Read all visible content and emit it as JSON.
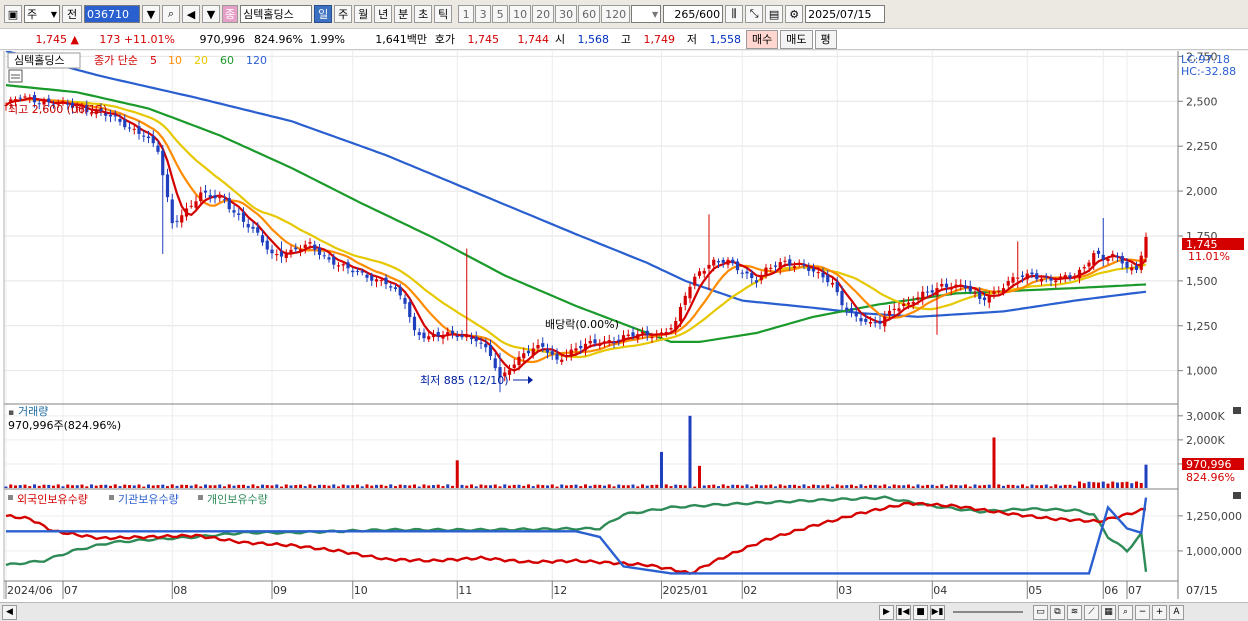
{
  "toolbar": {
    "period_type": "주",
    "prev_label": "전",
    "stock_code": "036710",
    "stock_name": "심텍홀딩스",
    "stock_badge": "종",
    "timeframes": [
      "일",
      "주",
      "월",
      "년",
      "분",
      "초",
      "틱"
    ],
    "selected_timeframe": "일",
    "intervals": [
      "1",
      "3",
      "5",
      "10",
      "20",
      "30",
      "60",
      "120"
    ],
    "count": "265",
    "count_max": "/600",
    "date": "2025/07/15"
  },
  "quote": {
    "price": "1,745",
    "arrow": "▲",
    "change": "173",
    "change_pct": "+11.01%",
    "volume": "970,996",
    "vol_ratio": "824.96%",
    "turnover": "1.99%",
    "amount": "1,641백만",
    "hoga_label": "호가",
    "ask": "1,745",
    "bid": "1,744",
    "open_label": "시",
    "open": "1,568",
    "high_label": "고",
    "high": "1,749",
    "low_label": "저",
    "low": "1,558",
    "buy_label": "매수",
    "sell_label": "매도",
    "eval_label": "평"
  },
  "chart_data": [
    {
      "type": "candlestick",
      "title": "심텍홀딩스",
      "legend": {
        "label": "종가 단순",
        "periods": [
          "5",
          "10",
          "20",
          "60",
          "120"
        ],
        "colors": [
          "#d40000",
          "#ff8c00",
          "#e6c800",
          "#1a9a2a",
          "#2a5fd0"
        ]
      },
      "x_ticks": [
        "2024/06",
        "07",
        "08",
        "09",
        "10",
        "11",
        "12",
        "2025/01",
        "02",
        "03",
        "04",
        "05",
        "06",
        "07"
      ],
      "y_ticks": [
        1000,
        1250,
        1500,
        1750,
        2000,
        2250,
        2500,
        2750
      ],
      "ylim": [
        820,
        2780
      ],
      "lc": "LC:97.18",
      "hc": "HC:-32.88",
      "annotations": {
        "high": "최고 2,600 (06/12)",
        "low": "최저 885 (12/10)",
        "dividend": "배당락(0.00%)"
      },
      "last_price_label": "1,745",
      "last_change_label": "11.01%",
      "close_anchors": [
        [
          0,
          2480
        ],
        [
          3,
          2520
        ],
        [
          8,
          2500
        ],
        [
          14,
          2470
        ],
        [
          20,
          2440
        ],
        [
          24,
          2380
        ],
        [
          29,
          2320
        ],
        [
          32,
          2220
        ],
        [
          34,
          1950
        ],
        [
          35,
          1820
        ],
        [
          38,
          1900
        ],
        [
          41,
          1980
        ],
        [
          46,
          1950
        ],
        [
          50,
          1830
        ],
        [
          53,
          1750
        ],
        [
          56,
          1650
        ],
        [
          60,
          1660
        ],
        [
          64,
          1700
        ],
        [
          68,
          1620
        ],
        [
          72,
          1560
        ],
        [
          77,
          1520
        ],
        [
          80,
          1490
        ],
        [
          84,
          1380
        ],
        [
          86,
          1220
        ],
        [
          89,
          1190
        ],
        [
          95,
          1200
        ],
        [
          99,
          1180
        ],
        [
          102,
          1080
        ],
        [
          104,
          950
        ],
        [
          106,
          1020
        ],
        [
          109,
          1100
        ],
        [
          113,
          1130
        ],
        [
          116,
          1060
        ],
        [
          118,
          1100
        ],
        [
          122,
          1140
        ],
        [
          127,
          1170
        ],
        [
          131,
          1190
        ],
        [
          134,
          1200
        ],
        [
          138,
          1210
        ],
        [
          141,
          1260
        ],
        [
          143,
          1420
        ],
        [
          146,
          1560
        ],
        [
          149,
          1610
        ],
        [
          152,
          1600
        ],
        [
          155,
          1550
        ],
        [
          158,
          1510
        ],
        [
          160,
          1560
        ],
        [
          164,
          1600
        ],
        [
          168,
          1590
        ],
        [
          171,
          1530
        ],
        [
          174,
          1480
        ],
        [
          176,
          1380
        ],
        [
          179,
          1300
        ],
        [
          182,
          1250
        ],
        [
          184,
          1270
        ],
        [
          187,
          1360
        ],
        [
          190,
          1370
        ],
        [
          193,
          1420
        ],
        [
          197,
          1480
        ],
        [
          202,
          1460
        ],
        [
          205,
          1400
        ],
        [
          209,
          1450
        ],
        [
          213,
          1520
        ],
        [
          216,
          1540
        ],
        [
          220,
          1500
        ],
        [
          224,
          1520
        ],
        [
          227,
          1580
        ],
        [
          229,
          1660
        ],
        [
          231,
          1610
        ],
        [
          233,
          1640
        ],
        [
          236,
          1590
        ],
        [
          238,
          1560
        ],
        [
          240,
          1745
        ]
      ],
      "ma120_anchors": [
        [
          0,
          2780
        ],
        [
          20,
          2640
        ],
        [
          40,
          2520
        ],
        [
          60,
          2390
        ],
        [
          80,
          2200
        ],
        [
          100,
          1980
        ],
        [
          120,
          1760
        ],
        [
          135,
          1600
        ],
        [
          143,
          1500
        ],
        [
          155,
          1390
        ],
        [
          170,
          1350
        ],
        [
          180,
          1320
        ],
        [
          192,
          1300
        ],
        [
          210,
          1330
        ],
        [
          225,
          1390
        ],
        [
          240,
          1440
        ]
      ],
      "ma60_anchors": [
        [
          0,
          2590
        ],
        [
          15,
          2550
        ],
        [
          30,
          2460
        ],
        [
          45,
          2310
        ],
        [
          60,
          2130
        ],
        [
          75,
          1930
        ],
        [
          90,
          1740
        ],
        [
          105,
          1530
        ],
        [
          120,
          1360
        ],
        [
          132,
          1240
        ],
        [
          140,
          1160
        ],
        [
          146,
          1160
        ],
        [
          158,
          1210
        ],
        [
          170,
          1300
        ],
        [
          184,
          1370
        ],
        [
          200,
          1430
        ],
        [
          225,
          1460
        ],
        [
          240,
          1480
        ]
      ],
      "spikes": [
        [
          33,
          1650,
          2050
        ],
        [
          58,
          1600,
          1720
        ],
        [
          97,
          1300,
          1680
        ],
        [
          104,
          880,
          1100
        ],
        [
          148,
          1450,
          1870
        ],
        [
          196,
          1200,
          1380
        ],
        [
          213,
          1460,
          1720
        ],
        [
          231,
          1580,
          1850
        ]
      ]
    },
    {
      "type": "bar",
      "title": "거래량",
      "value_label": "970,996주(824.96%)",
      "y_ticks": [
        "3,000K",
        "2,000K",
        "1,000K"
      ],
      "ylim": [
        0,
        3200
      ],
      "last_labels": [
        "970,996",
        "824.96%"
      ],
      "base_level": 60,
      "spikes": [
        [
          95,
          1150
        ],
        [
          138,
          1500
        ],
        [
          144,
          3000
        ],
        [
          146,
          920
        ],
        [
          208,
          2100
        ],
        [
          240,
          970
        ]
      ]
    },
    {
      "type": "line",
      "series_labels": [
        "외국인보유수량",
        "기관보유수량",
        "개인보유수량"
      ],
      "colors": [
        "#d40000",
        "#2a5fd0",
        "#2e8b57"
      ],
      "y_ticks": [
        "1,250,000",
        "1,000,000"
      ],
      "ylim": [
        800000,
        1420000
      ],
      "red_anchors": [
        [
          0,
          1250000
        ],
        [
          5,
          1230000
        ],
        [
          10,
          1140000
        ],
        [
          20,
          1090000
        ],
        [
          30,
          1100000
        ],
        [
          40,
          1110000
        ],
        [
          50,
          1060000
        ],
        [
          60,
          1040000
        ],
        [
          70,
          1000000
        ],
        [
          80,
          940000
        ],
        [
          90,
          930000
        ],
        [
          100,
          950000
        ],
        [
          110,
          920000
        ],
        [
          120,
          930000
        ],
        [
          130,
          910000
        ],
        [
          135,
          900000
        ],
        [
          140,
          870000
        ],
        [
          144,
          840000
        ],
        [
          150,
          940000
        ],
        [
          160,
          1080000
        ],
        [
          170,
          1180000
        ],
        [
          180,
          1270000
        ],
        [
          190,
          1340000
        ],
        [
          200,
          1320000
        ],
        [
          210,
          1270000
        ],
        [
          220,
          1230000
        ],
        [
          230,
          1210000
        ],
        [
          236,
          1260000
        ],
        [
          240,
          1300000
        ]
      ],
      "blue_anchors": [
        [
          0,
          1140000
        ],
        [
          10,
          1140000
        ],
        [
          70,
          1140000
        ],
        [
          120,
          1140000
        ],
        [
          125,
          1100000
        ],
        [
          130,
          890000
        ],
        [
          140,
          840000
        ],
        [
          228,
          840000
        ],
        [
          232,
          1310000
        ],
        [
          236,
          1160000
        ],
        [
          239,
          1130000
        ],
        [
          240,
          1380000
        ]
      ],
      "green_anchors": [
        [
          0,
          900000
        ],
        [
          8,
          930000
        ],
        [
          14,
          1000000
        ],
        [
          22,
          1060000
        ],
        [
          30,
          1080000
        ],
        [
          40,
          1100000
        ],
        [
          50,
          1130000
        ],
        [
          60,
          1130000
        ],
        [
          80,
          1150000
        ],
        [
          100,
          1150000
        ],
        [
          125,
          1160000
        ],
        [
          130,
          1260000
        ],
        [
          140,
          1310000
        ],
        [
          150,
          1330000
        ],
        [
          170,
          1360000
        ],
        [
          185,
          1380000
        ],
        [
          195,
          1320000
        ],
        [
          205,
          1280000
        ],
        [
          215,
          1300000
        ],
        [
          225,
          1290000
        ],
        [
          229,
          1260000
        ],
        [
          232,
          1100000
        ],
        [
          236,
          1000000
        ],
        [
          239,
          1120000
        ],
        [
          240,
          850000
        ]
      ]
    }
  ],
  "scrollbar": {
    "buttons": [
      "▶",
      "▮◀",
      "■",
      "▶▮"
    ],
    "zoom_buttons": [
      "−",
      "+",
      "A"
    ]
  }
}
